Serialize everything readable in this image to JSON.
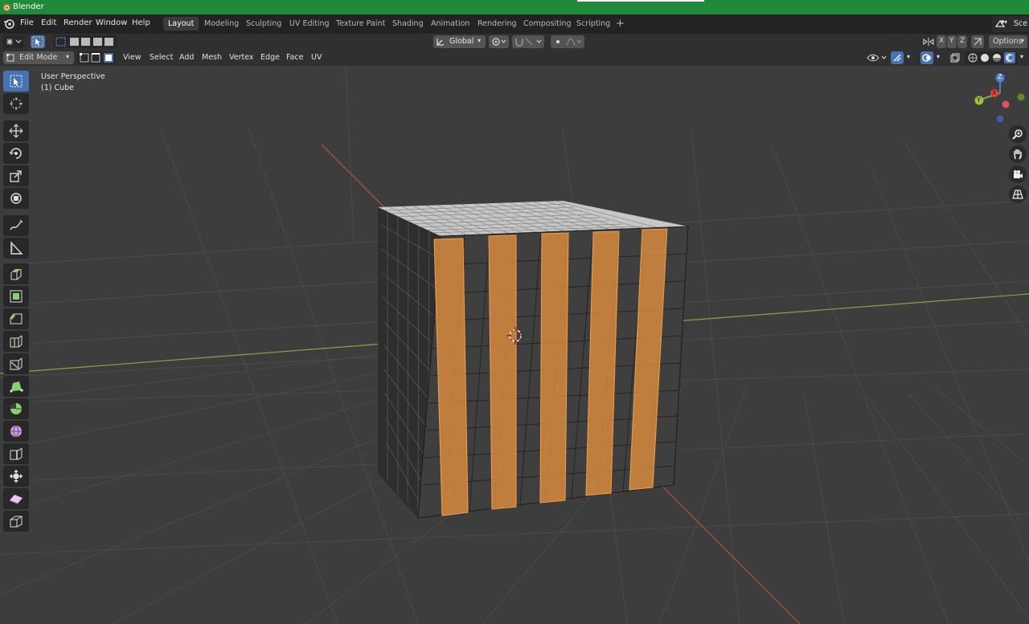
{
  "window": {
    "title": "Blender"
  },
  "menu": [
    "File",
    "Edit",
    "Render",
    "Window",
    "Help"
  ],
  "workspaces": [
    "Layout",
    "Modeling",
    "Sculpting",
    "UV Editing",
    "Texture Paint",
    "Shading",
    "Animation",
    "Rendering",
    "Compositing",
    "Scripting"
  ],
  "workspace_add": "+",
  "scene_label": "Sce",
  "header": {
    "orientation": "Global",
    "axes": [
      "X",
      "Y",
      "Z"
    ],
    "options": "Options",
    "mode": "Edit Mode",
    "menus": [
      "View",
      "Select",
      "Add",
      "Mesh",
      "Vertex",
      "Edge",
      "Face",
      "UV"
    ]
  },
  "viewport": {
    "perspective_label": "User Perspective",
    "object_label": "(1) Cube",
    "gizmo": {
      "z": "Z",
      "x": "X",
      "y": "Y"
    }
  },
  "colors": {
    "titlebar": "#1f8a3a",
    "active_blue": "#4772b3",
    "selection_orange": "#e8923c",
    "x_axis": "#c04a4a",
    "y_axis": "#7fa84a"
  },
  "tools": [
    "select-box-icon",
    "cursor-icon",
    "move-icon",
    "rotate-icon",
    "scale-icon",
    "transform-icon",
    "annotate-icon",
    "measure-icon",
    "extrude-icon",
    "inset-icon",
    "bevel-icon",
    "loop-cut-icon",
    "knife-icon",
    "poly-build-icon",
    "spin-icon",
    "smooth-icon",
    "edge-slide-icon",
    "shrink-fatten-icon",
    "shear-icon",
    "rip-icon"
  ]
}
